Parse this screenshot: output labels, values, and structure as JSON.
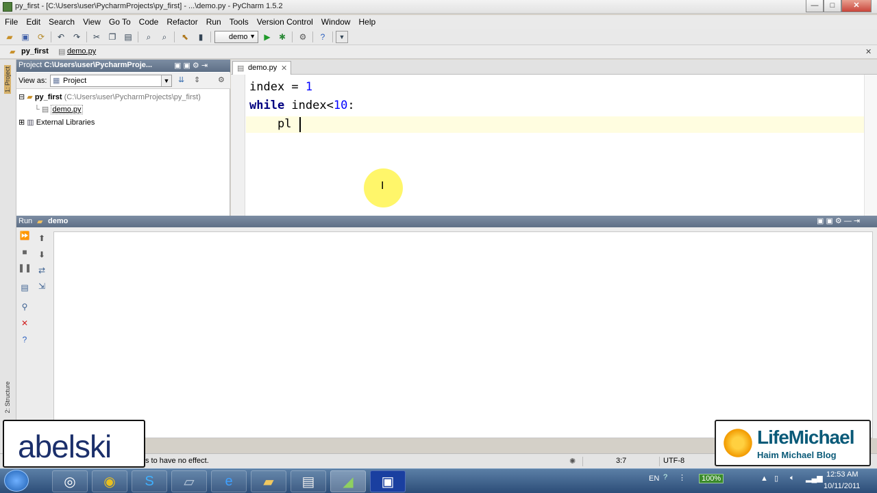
{
  "window": {
    "title": "py_first - [C:\\Users\\user\\PycharmProjects\\py_first] - ...\\demo.py - PyCharm 1.5.2",
    "controls": {
      "minimize": "—",
      "maximize": "□",
      "close": "✕"
    }
  },
  "menu": [
    "File",
    "Edit",
    "Search",
    "View",
    "Go To",
    "Code",
    "Refactor",
    "Run",
    "Tools",
    "Version Control",
    "Window",
    "Help"
  ],
  "toolbar": {
    "run_config": "demo",
    "icons": [
      "open-icon",
      "save-icon",
      "sync-icon",
      "undo-icon",
      "redo-icon",
      "cut-icon",
      "copy-icon",
      "paste-icon",
      "find-icon",
      "replace-icon",
      "back-icon",
      "forward-icon",
      "run-icon",
      "debug-icon",
      "settings-icon",
      "help-icon"
    ]
  },
  "navbar": {
    "project": "py_first",
    "file": "demo.py"
  },
  "sidebar": {
    "tab_project": "1: Project",
    "tab_structure": "2: Structure"
  },
  "project_panel": {
    "header_label": "Project",
    "header_path": "C:\\Users\\user\\PycharmProje...",
    "view_as_label": "View as:",
    "view_as_value": "Project",
    "tree": [
      {
        "label": "py_first",
        "detail": "(C:\\Users\\user\\PycharmProjects\\py_first)"
      },
      {
        "label": "demo.py",
        "detail": ""
      },
      {
        "label": "External Libraries",
        "detail": ""
      }
    ]
  },
  "editor": {
    "tab": "demo.py",
    "lines": {
      "l1": {
        "a": "index = ",
        "num": "1"
      },
      "l2": {
        "kw": "while",
        "b": " index<",
        "num": "10",
        "c": ":"
      },
      "l3": {
        "indent": "    ",
        "text": "pl"
      }
    }
  },
  "run_panel": {
    "label": "Run",
    "config": "demo"
  },
  "status_bar": {
    "message": "s to have no effect.",
    "position": "3:7",
    "encoding": "UTF-8"
  },
  "taskbar": {
    "lang": "EN",
    "battery": "100%",
    "time": "12:53 AM",
    "date": "10/11/2011"
  },
  "overlays": {
    "left_logo": "abelski",
    "right_logo": "LifeMichael",
    "right_subtitle": "Haim Michael Blog"
  }
}
